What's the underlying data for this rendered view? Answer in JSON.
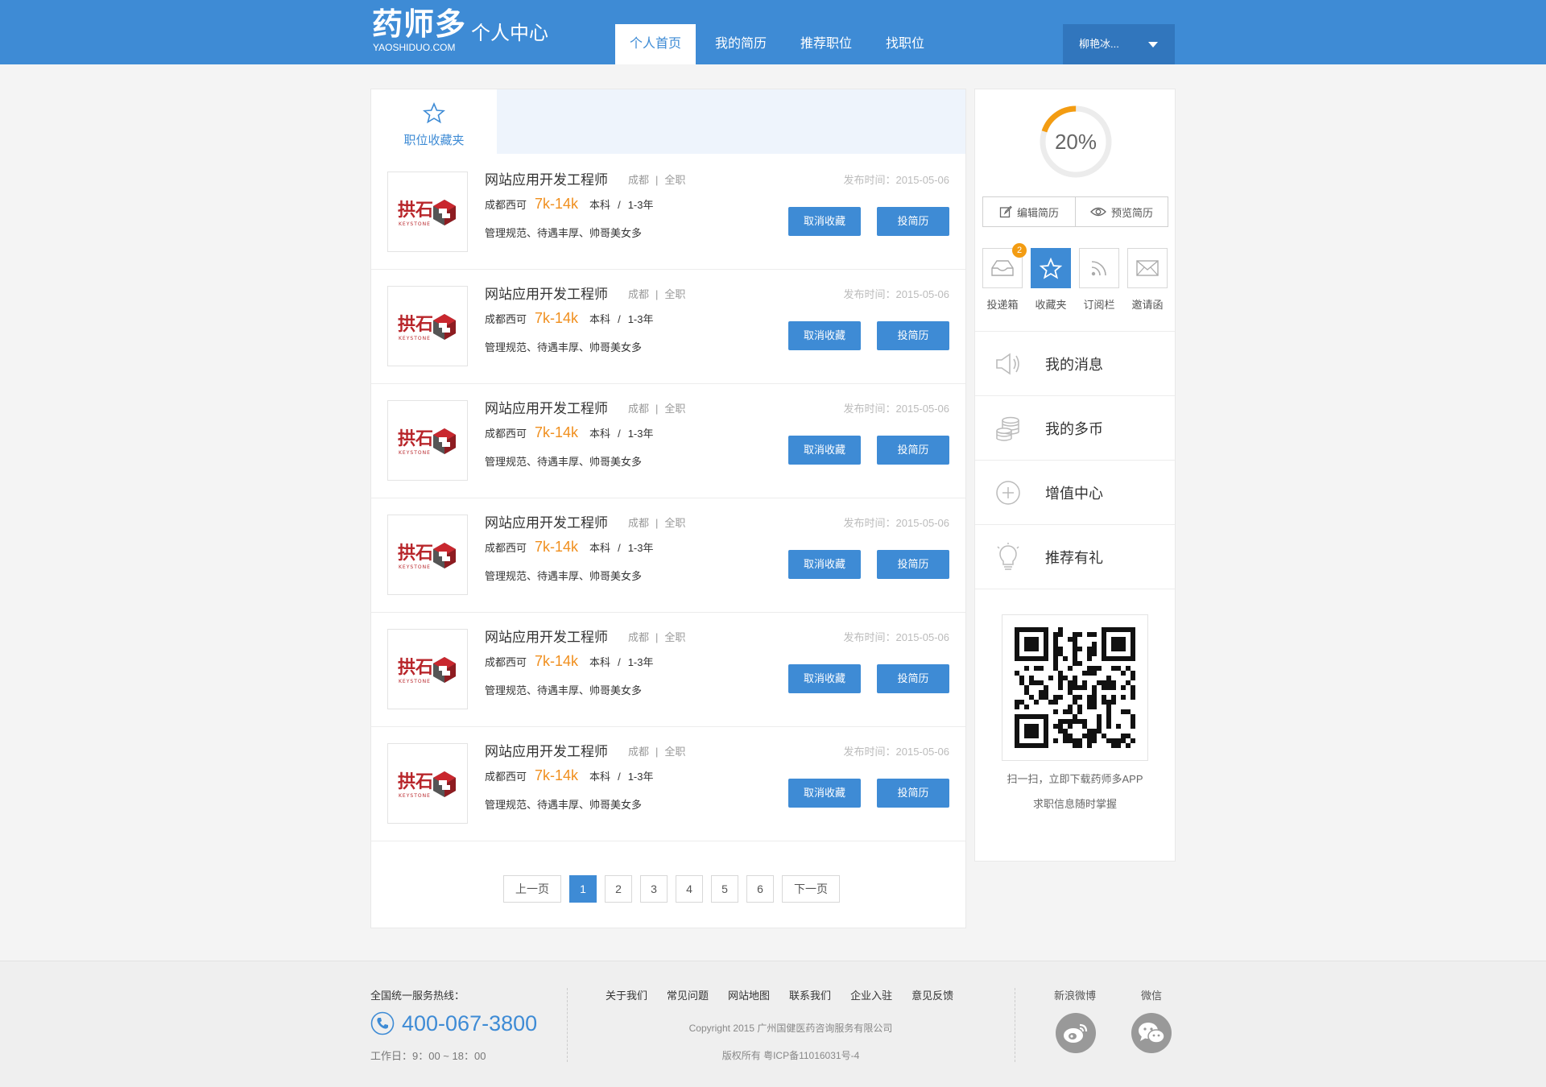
{
  "header": {
    "logo": "药师多",
    "logo_sub": "YAOSHIDUO.COM",
    "section_title": "个人中心",
    "nav": [
      "个人首页",
      "我的简历",
      "推荐职位",
      "找职位"
    ],
    "user": "柳艳冰..."
  },
  "tab": {
    "label": "职位收藏夹"
  },
  "jobs": [
    {
      "title": "网站应用开发工程师",
      "city": "成都",
      "type": "全职",
      "date": "发布时间：2015-05-06",
      "company": "成都西可",
      "salary": "7k-14k",
      "degree": "本科",
      "slash": "/",
      "exp": "1-3年",
      "tags": "管理规范、待遇丰厚、帅哥美女多",
      "logo_cn": "拱石",
      "logo_en": "KEYSTONE",
      "cancel": "取消收藏",
      "apply": "投简历"
    },
    {
      "title": "网站应用开发工程师",
      "city": "成都",
      "type": "全职",
      "date": "发布时间：2015-05-06",
      "company": "成都西可",
      "salary": "7k-14k",
      "degree": "本科",
      "slash": "/",
      "exp": "1-3年",
      "tags": "管理规范、待遇丰厚、帅哥美女多",
      "logo_cn": "拱石",
      "logo_en": "KEYSTONE",
      "cancel": "取消收藏",
      "apply": "投简历"
    },
    {
      "title": "网站应用开发工程师",
      "city": "成都",
      "type": "全职",
      "date": "发布时间：2015-05-06",
      "company": "成都西可",
      "salary": "7k-14k",
      "degree": "本科",
      "slash": "/",
      "exp": "1-3年",
      "tags": "管理规范、待遇丰厚、帅哥美女多",
      "logo_cn": "拱石",
      "logo_en": "KEYSTONE",
      "cancel": "取消收藏",
      "apply": "投简历"
    },
    {
      "title": "网站应用开发工程师",
      "city": "成都",
      "type": "全职",
      "date": "发布时间：2015-05-06",
      "company": "成都西可",
      "salary": "7k-14k",
      "degree": "本科",
      "slash": "/",
      "exp": "1-3年",
      "tags": "管理规范、待遇丰厚、帅哥美女多",
      "logo_cn": "拱石",
      "logo_en": "KEYSTONE",
      "cancel": "取消收藏",
      "apply": "投简历"
    },
    {
      "title": "网站应用开发工程师",
      "city": "成都",
      "type": "全职",
      "date": "发布时间：2015-05-06",
      "company": "成都西可",
      "salary": "7k-14k",
      "degree": "本科",
      "slash": "/",
      "exp": "1-3年",
      "tags": "管理规范、待遇丰厚、帅哥美女多",
      "logo_cn": "拱石",
      "logo_en": "KEYSTONE",
      "cancel": "取消收藏",
      "apply": "投简历"
    },
    {
      "title": "网站应用开发工程师",
      "city": "成都",
      "type": "全职",
      "date": "发布时间：2015-05-06",
      "company": "成都西可",
      "salary": "7k-14k",
      "degree": "本科",
      "slash": "/",
      "exp": "1-3年",
      "tags": "管理规范、待遇丰厚、帅哥美女多",
      "logo_cn": "拱石",
      "logo_en": "KEYSTONE",
      "cancel": "取消收藏",
      "apply": "投简历"
    }
  ],
  "pager": {
    "prev": "上一页",
    "pages": [
      "1",
      "2",
      "3",
      "4",
      "5",
      "6"
    ],
    "next": "下一页",
    "current": "1"
  },
  "sidebar": {
    "completion_value": 0.2,
    "completion_text": "20%",
    "edit": "编辑简历",
    "preview": "预览简历",
    "quick": [
      {
        "label": "投递箱",
        "icon": "inbox-icon",
        "badge": "2"
      },
      {
        "label": "收藏夹",
        "icon": "star-icon",
        "active": true
      },
      {
        "label": "订阅栏",
        "icon": "rss-icon"
      },
      {
        "label": "邀请函",
        "icon": "mail-icon"
      }
    ],
    "menu": [
      {
        "label": "我的消息",
        "icon": "speaker-icon"
      },
      {
        "label": "我的多币",
        "icon": "coins-icon"
      },
      {
        "label": "增值中心",
        "icon": "plus-circle-icon"
      },
      {
        "label": "推荐有礼",
        "icon": "lightbulb-icon"
      }
    ],
    "qr_text1": "扫一扫，立即下载药师多APP",
    "qr_text2": "求职信息随时掌握"
  },
  "footer": {
    "hotline_label": "全国统一服务热线：",
    "phone": "400-067-3800",
    "hours": "工作日：9：00 ~ 18：00",
    "links": [
      "关于我们",
      "常见问题",
      "网站地图",
      "联系我们",
      "企业入驻",
      "意见反馈"
    ],
    "copyright": "Copyright 2015 广州国健医药咨询服务有限公司",
    "icp": "版权所有 粤ICP备11016031号-4",
    "weibo": "新浪微博",
    "wechat": "微信"
  },
  "colors": {
    "primary": "#3e8bd5",
    "salary": "#f08f1e",
    "progress": "#f39c12",
    "logo_red": "#b8262b"
  }
}
